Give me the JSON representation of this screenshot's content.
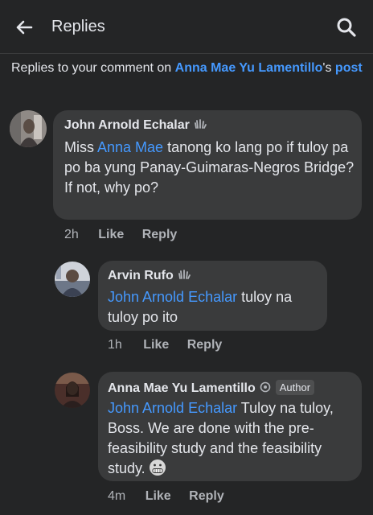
{
  "header": {
    "title": "Replies"
  },
  "context": {
    "prefix": "Replies to your comment on ",
    "author": "Anna Mae Yu Lamentillo",
    "suffix": "'s",
    "post": "post"
  },
  "comments": [
    {
      "author": "John Arnold Echalar",
      "mention": "Anna Mae",
      "text_before": "Miss ",
      "text_after": " tanong ko lang po if tuloy pa po ba yung Panay-Guimaras-Negros Bridge? If not, why po?",
      "time": "2h",
      "like": "Like",
      "reply": "Reply"
    },
    {
      "author": "Arvin Rufo",
      "mention": "John Arnold Echalar",
      "text_after": " tuloy na tuloy po ito",
      "time": "1h",
      "like": "Like",
      "reply": "Reply"
    },
    {
      "author": "Anna Mae Yu Lamentillo",
      "badge": "Author",
      "mention": "John Arnold Echalar",
      "text_after": " Tuloy na tuloy, Boss. We are done with the pre-feasibility study and the feasibility study.",
      "time": "4m",
      "like": "Like",
      "reply": "Reply"
    }
  ]
}
